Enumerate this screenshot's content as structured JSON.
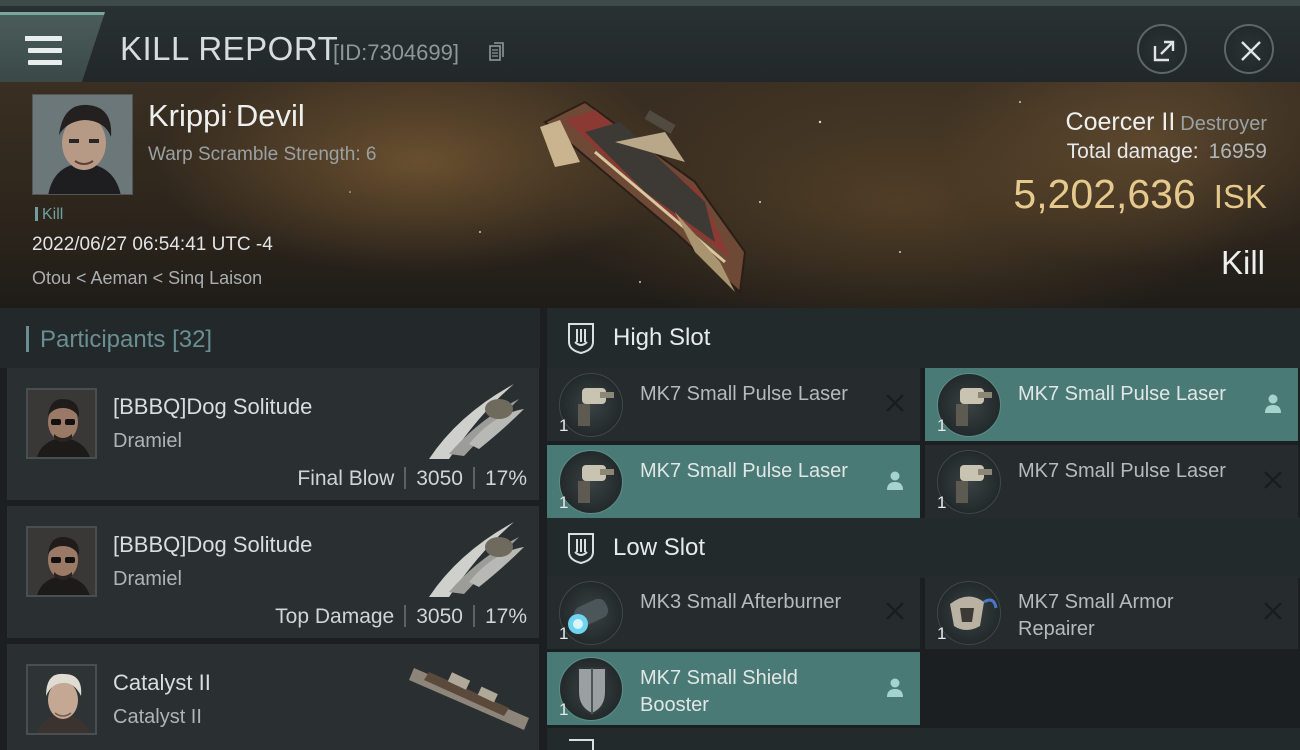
{
  "header": {
    "title": "KILL REPORT",
    "report_id": "[ID:7304699]",
    "menu_icon": "hamburger-icon",
    "share_icon": "share-icon",
    "close_icon": "close-icon"
  },
  "victim": {
    "name": "Krippi Devil",
    "warp_scramble": "Warp Scramble Strength: 6",
    "kill_tag": "Kill",
    "timestamp": "2022/06/27 06:54:41 UTC -4",
    "location": "Otou < Aeman < Sinq Laison",
    "ship_name": "Coercer II",
    "ship_class": "Destroyer",
    "total_damage_label": "Total damage:",
    "total_damage": "16959",
    "isk_value": "5,202,636",
    "isk_unit": "ISK",
    "result": "Kill"
  },
  "participants": {
    "label": "Participants",
    "count": "[32]",
    "rows": [
      {
        "name": "[BBBQ]Dog Solitude",
        "ship": "Dramiel",
        "role": "Final Blow",
        "damage": "3050",
        "percent": "17%"
      },
      {
        "name": "[BBBQ]Dog Solitude",
        "ship": "Dramiel",
        "role": "Top Damage",
        "damage": "3050",
        "percent": "17%"
      },
      {
        "name": "Catalyst II",
        "ship": "Catalyst II"
      }
    ]
  },
  "slots": {
    "high": {
      "label": "High Slot",
      "modules": [
        {
          "name": "MK7 Small Pulse Laser",
          "qty": "1",
          "state": "destroyed"
        },
        {
          "name": "MK7 Small Pulse Laser",
          "qty": "1",
          "state": "dropped"
        },
        {
          "name": "MK7 Small Pulse Laser",
          "qty": "1",
          "state": "dropped"
        },
        {
          "name": "MK7 Small Pulse Laser",
          "qty": "1",
          "state": "destroyed"
        }
      ]
    },
    "low": {
      "label": "Low Slot",
      "modules": [
        {
          "name": "MK3 Small Afterburner",
          "qty": "1",
          "state": "destroyed"
        },
        {
          "name": "MK7 Small Armor Repairer",
          "qty": "1",
          "state": "destroyed"
        },
        {
          "name": "MK7 Small Shield Booster",
          "qty": "1",
          "state": "dropped"
        }
      ]
    }
  },
  "colors": {
    "accent_teal": "#4a7a76",
    "isk_gold": "#e6c98c",
    "panel_dark": "#262c2e"
  }
}
